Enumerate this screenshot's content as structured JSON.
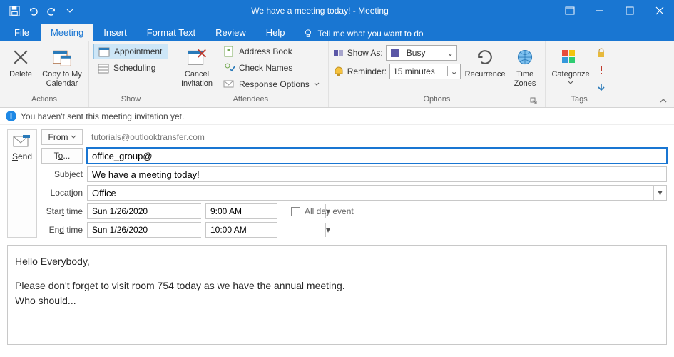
{
  "window": {
    "title": "We have a meeting today!  -  Meeting"
  },
  "tabs": {
    "file": "File",
    "meeting": "Meeting",
    "insert": "Insert",
    "formatText": "Format Text",
    "review": "Review",
    "help": "Help",
    "tellMe": "Tell me what you want to do"
  },
  "ribbon": {
    "actions": {
      "delete": "Delete",
      "copyToMyCalendar": "Copy to My Calendar",
      "label": "Actions"
    },
    "show": {
      "appointment": "Appointment",
      "scheduling": "Scheduling",
      "label": "Show"
    },
    "attendees": {
      "cancel": "Cancel Invitation",
      "addressBook": "Address Book",
      "checkNames": "Check Names",
      "responseOptions": "Response Options",
      "label": "Attendees"
    },
    "options": {
      "showAs": "Show As:",
      "showAsValue": "Busy",
      "reminder": "Reminder:",
      "reminderValue": "15 minutes",
      "recurrence": "Recurrence",
      "timeZones": "Time Zones",
      "label": "Options"
    },
    "tags": {
      "categorize": "Categorize",
      "label": "Tags"
    }
  },
  "infoBar": "You haven't sent this meeting invitation yet.",
  "compose": {
    "send": "Send",
    "fromLabel": "From",
    "fromValue": "tutorials@outlooktransfer.com",
    "toLabel": "To...",
    "toValue": "office_group@",
    "subjectLabel": "Subject",
    "subjectValue": "We have a meeting today!",
    "locationLabel": "Location",
    "locationValue": "Office",
    "startLabel": "Start time",
    "startDate": "Sun 1/26/2020",
    "startTime": "9:00 AM",
    "endLabel": "End time",
    "endDate": "Sun 1/26/2020",
    "endTime": "10:00 AM",
    "allDay": "All day event",
    "bodyLine1": "Hello Everybody,",
    "bodyLine2": "Please don't forget to visit room 754 today as we have the annual meeting.",
    "bodyLine3": "Who should..."
  }
}
